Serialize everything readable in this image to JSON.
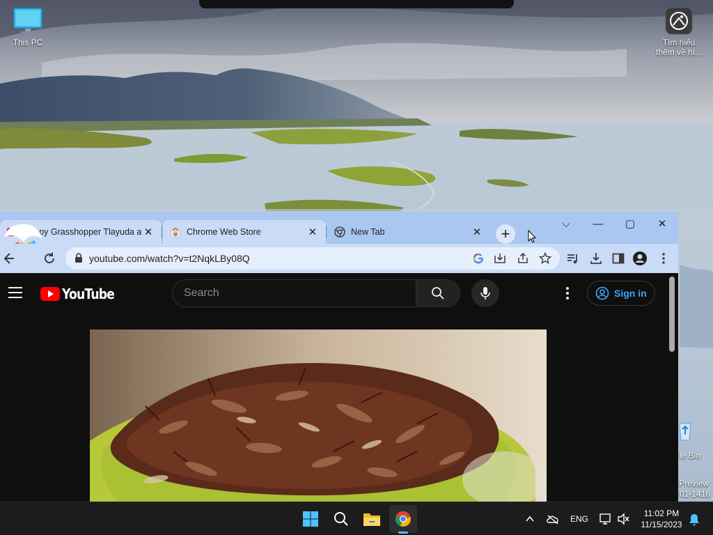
{
  "desktop": {
    "icons": [
      {
        "label": "This PC"
      },
      {
        "label_line1": "Tìm hiểu",
        "label_line2": "thêm về hì..."
      }
    ],
    "partial_labels": [
      "le Bin",
      "Preview",
      "01-1416"
    ]
  },
  "browser": {
    "tabs": [
      {
        "title": "Crispy Grasshopper Tlayuda and",
        "close": "✕"
      },
      {
        "title": "Chrome Web Store",
        "close": "✕"
      },
      {
        "title": "New Tab",
        "close": "✕"
      }
    ],
    "new_tab": "+",
    "window_controls": {
      "dropdown": "⌵",
      "minimize": "—",
      "maximize": "▢",
      "close": "✕"
    },
    "address": {
      "url": "youtube.com/watch?v=t2NqkLBy08Q"
    }
  },
  "youtube": {
    "logo_text": "YouTube",
    "search": {
      "placeholder": "Search",
      "value": ""
    },
    "sign_in_label": "Sign in"
  },
  "taskbar": {
    "apps": [
      "start-icon",
      "search-icon",
      "file-explorer-icon",
      "chrome-icon"
    ],
    "tray": {
      "language": "ENG",
      "time": "11:02 PM",
      "date": "11/15/2023"
    }
  },
  "colors": {
    "tab_strip": "#a9c7f0",
    "active_tab": "#c9dbf6",
    "youtube_bg": "#0f0f0f",
    "youtube_red": "#ff0000",
    "sign_in_blue": "#3ea6ff",
    "taskbar": "#1c1c1c"
  }
}
